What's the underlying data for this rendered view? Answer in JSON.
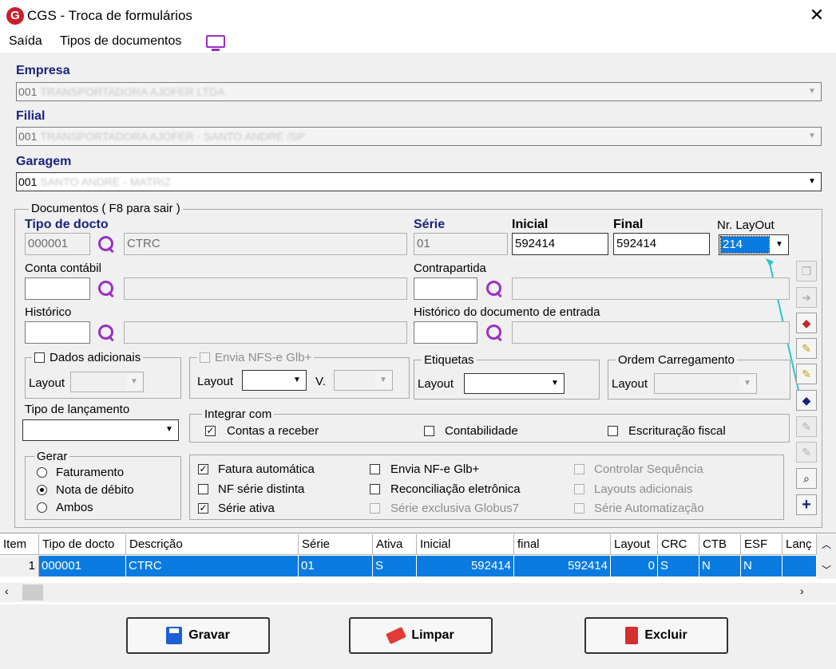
{
  "window": {
    "title": "CGS - Troca de formulários",
    "logo_letter": "G"
  },
  "menu": {
    "items": [
      "Saída",
      "Tipos de documentos"
    ]
  },
  "empresa": {
    "label": "Empresa",
    "code": "001",
    "name": "TRANSPORTADORA AJOFER LTDA"
  },
  "filial": {
    "label": "Filial",
    "code": "001",
    "name": "TRANSPORTADORA AJOFER - SANTO ANDRE /SP"
  },
  "garagem": {
    "label": "Garagem",
    "code": "001",
    "name": "SANTO ANDRE - MATRIZ"
  },
  "documentos": {
    "group_title": "Documentos ( F8 para sair )",
    "tipo_docto_label": "Tipo de docto",
    "tipo_docto_code": "000001",
    "tipo_docto_desc": "CTRC",
    "serie_label": "Série",
    "serie_value": "01",
    "inicial_label": "Inicial",
    "inicial_value": "592414",
    "final_label": "Final",
    "final_value": "592414",
    "layout_label": "Nr. LayOut",
    "layout_value": "214",
    "conta_label": "Conta contábil",
    "contrapartida_label": "Contrapartida",
    "historico_label": "Histórico",
    "hist_entrada_label": "Histórico do documento de entrada"
  },
  "dados_adicionais": {
    "title": "Dados adicionais",
    "layout_label": "Layout"
  },
  "nfse": {
    "title": "Envia NFS-e Glb+",
    "layout_label": "Layout",
    "v_label": "V."
  },
  "etiquetas": {
    "title": "Etiquetas",
    "layout_label": "Layout"
  },
  "ordem": {
    "title": "Ordem Carregamento",
    "layout_label": "Layout"
  },
  "tipo_lanc": {
    "label": "Tipo de lançamento"
  },
  "integrar": {
    "title": "Integrar com",
    "contas_receber": "Contas a receber",
    "contabilidade": "Contabilidade",
    "escrituracao": "Escrituração fiscal"
  },
  "gerar": {
    "title": "Gerar",
    "options": [
      "Faturamento",
      "Nota de débito",
      "Ambos"
    ],
    "selected": "Nota de débito"
  },
  "options": {
    "fatura_auto": "Fatura automática",
    "nf_serie_distinta": "NF série distinta",
    "serie_ativa": "Série ativa",
    "envia_nfe": "Envia NF-e Glb+",
    "reconciliacao": "Reconciliação eletrônica",
    "serie_exclusiva": "Série exclusiva Globus7",
    "controlar_seq": "Controlar Sequência",
    "layouts_adicionais": "Layouts adicionais",
    "serie_automatizacao": "Série Automatização"
  },
  "grid": {
    "headers": [
      "Item",
      "Tipo de docto",
      "Descrição",
      "Série",
      "Ativa",
      "Inicial",
      "final",
      "Layout",
      "CRC",
      "CTB",
      "ESF",
      "Lanç"
    ],
    "row": [
      "1",
      "000001",
      "CTRC",
      "01",
      "S",
      "592414",
      "592414",
      "0",
      "S",
      "N",
      "N",
      ""
    ]
  },
  "buttons": {
    "gravar": "Gravar",
    "limpar": "Limpar",
    "excluir": "Excluir"
  },
  "colors": {
    "selection": "#0a7be0",
    "label_blue": "#1a237e",
    "icon_purple": "#9b2fc5"
  }
}
